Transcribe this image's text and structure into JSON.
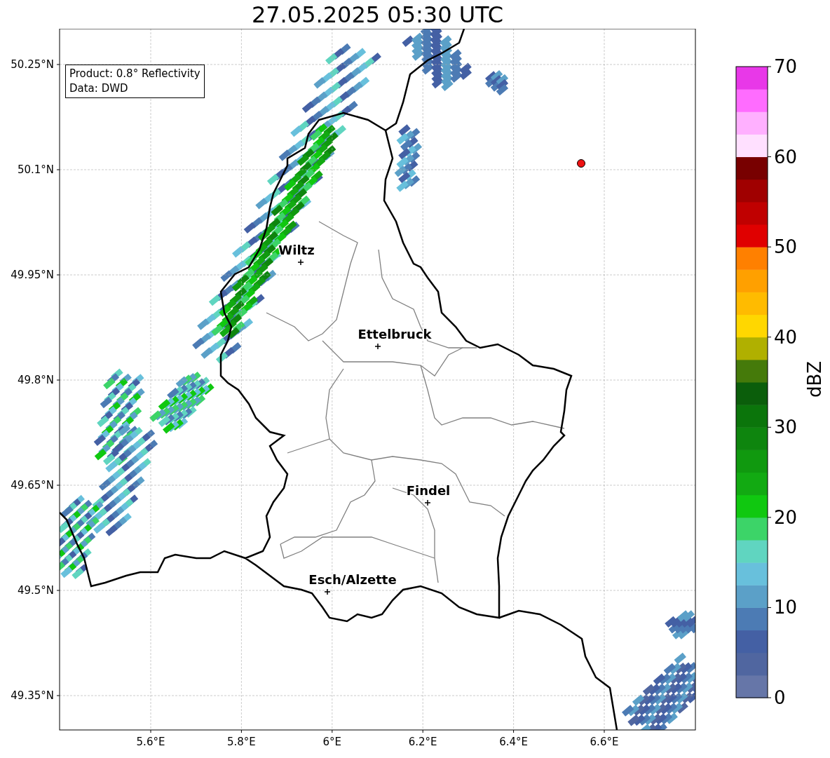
{
  "title": "27.05.2025 05:30 UTC",
  "legend": [
    "Product: 0.8° Reflectivity",
    "Data: DWD"
  ],
  "map": {
    "yticks": [
      "50.25°N",
      "50.1°N",
      "49.95°N",
      "49.8°N",
      "49.65°N",
      "49.5°N",
      "49.35°N"
    ],
    "xticks": [
      "5.6°E",
      "5.8°E",
      "6°E",
      "6.2°E",
      "6.4°E",
      "6.6°E"
    ],
    "cities": [
      {
        "name": "Wiltz"
      },
      {
        "name": "Ettelbruck"
      },
      {
        "name": "Findel"
      },
      {
        "name": "Esch/Alzette"
      }
    ]
  },
  "colorbar": {
    "label": "dBZ",
    "ticks": [
      "70",
      "60",
      "50",
      "40",
      "30",
      "20",
      "10",
      "0"
    ],
    "segments": [
      {
        "color": "#6676a8"
      },
      {
        "color": "#5066a0"
      },
      {
        "color": "#4460a4"
      },
      {
        "color": "#4c7bb4"
      },
      {
        "color": "#5ba0c8"
      },
      {
        "color": "#68c0dc"
      },
      {
        "color": "#60d5c0"
      },
      {
        "color": "#3cd468"
      },
      {
        "color": "#10c810"
      },
      {
        "color": "#12aa12"
      },
      {
        "color": "#10990f"
      },
      {
        "color": "#0e850e"
      },
      {
        "color": "#0b750b"
      },
      {
        "color": "#0b5e0b"
      },
      {
        "color": "#457a0a"
      },
      {
        "color": "#b0b000"
      },
      {
        "color": "#ffd700"
      },
      {
        "color": "#ffbb00"
      },
      {
        "color": "#ffa000"
      },
      {
        "color": "#ff8000"
      },
      {
        "color": "#e00000"
      },
      {
        "color": "#c00000"
      },
      {
        "color": "#a00000"
      },
      {
        "color": "#780000"
      },
      {
        "color": "#ffe0ff"
      },
      {
        "color": "#ffb0ff"
      },
      {
        "color": "#ff6cff"
      },
      {
        "color": "#e838e8"
      }
    ]
  }
}
